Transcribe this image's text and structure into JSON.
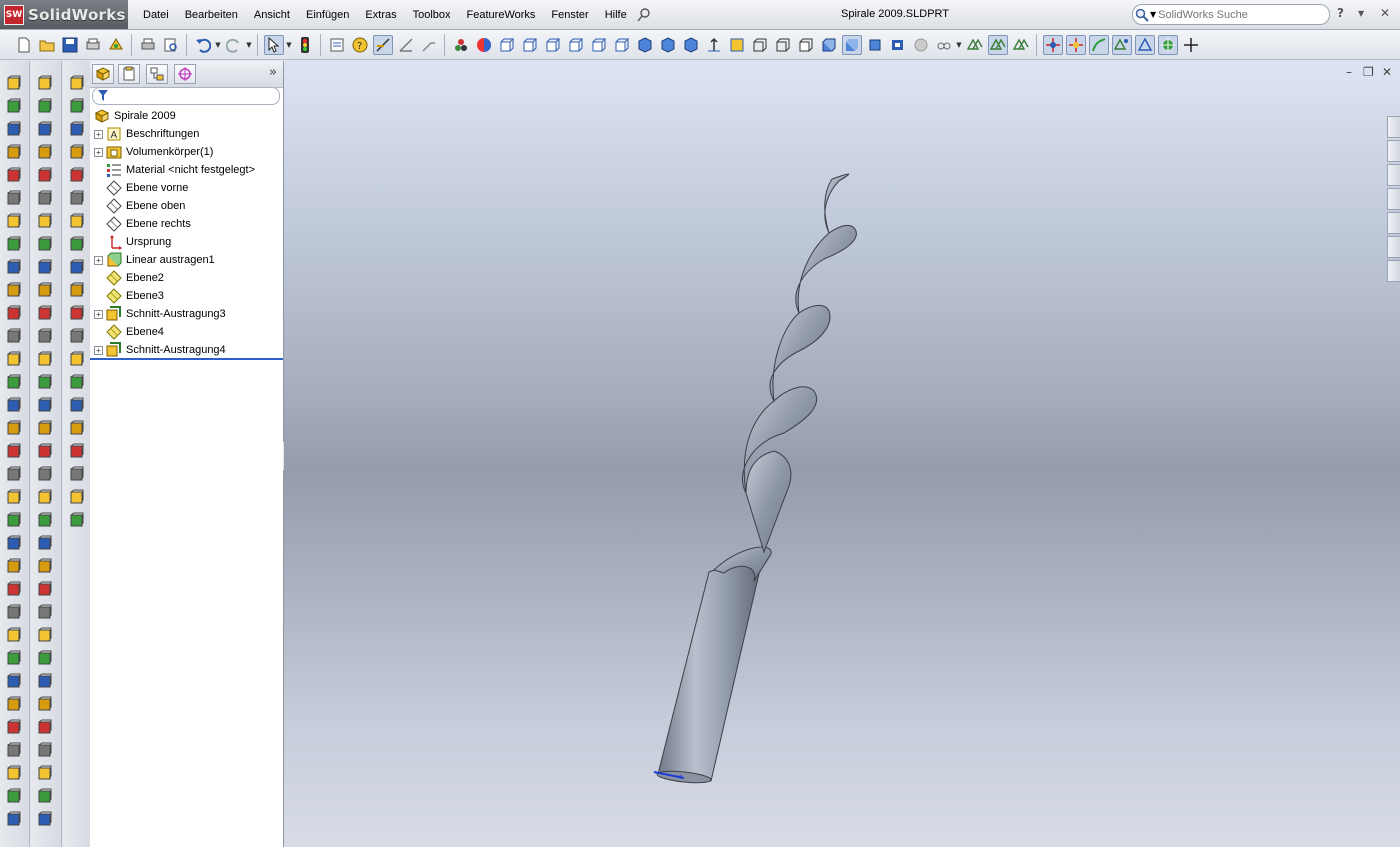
{
  "app": {
    "logo_text": "SolidWorks",
    "document_title": "Spirale 2009.SLDPRT"
  },
  "menu": [
    "Datei",
    "Bearbeiten",
    "Ansicht",
    "Einfügen",
    "Extras",
    "Toolbox",
    "FeatureWorks",
    "Fenster",
    "Hilfe"
  ],
  "search": {
    "placeholder": "SolidWorks Suche"
  },
  "help": {
    "label": "?"
  },
  "feature_manager": {
    "root": "Spirale 2009",
    "nodes": [
      {
        "label": "Beschriftungen",
        "expandable": true,
        "icon": "annotations-icon"
      },
      {
        "label": "Volumenkörper(1)",
        "expandable": true,
        "icon": "solid-bodies-icon"
      },
      {
        "label": "Material <nicht festgelegt>",
        "expandable": false,
        "icon": "material-icon"
      },
      {
        "label": "Ebene vorne",
        "expandable": false,
        "icon": "plane-icon"
      },
      {
        "label": "Ebene oben",
        "expandable": false,
        "icon": "plane-icon"
      },
      {
        "label": "Ebene rechts",
        "expandable": false,
        "icon": "plane-icon"
      },
      {
        "label": "Ursprung",
        "expandable": false,
        "icon": "origin-icon"
      },
      {
        "label": "Linear austragen1",
        "expandable": true,
        "icon": "extrude-icon"
      },
      {
        "label": "Ebene2",
        "expandable": false,
        "icon": "ref-plane-icon"
      },
      {
        "label": "Ebene3",
        "expandable": false,
        "icon": "ref-plane-icon"
      },
      {
        "label": "Schnitt-Austragung3",
        "expandable": true,
        "icon": "loft-icon"
      },
      {
        "label": "Ebene4",
        "expandable": false,
        "icon": "ref-plane-icon"
      },
      {
        "label": "Schnitt-Austragung4",
        "expandable": true,
        "icon": "loft-icon"
      }
    ]
  },
  "colors": {
    "accent": "#2f5fc9",
    "model_fill": "#9aa3b4",
    "rollback_bar": "#2f5fc9"
  }
}
